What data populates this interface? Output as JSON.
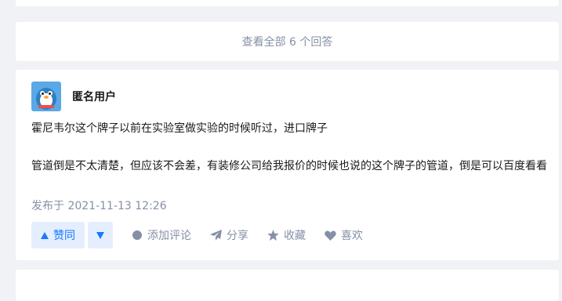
{
  "view_all": {
    "label": "查看全部 6 个回答"
  },
  "answer": {
    "author": "匿名用户",
    "paragraphs": [
      "霍尼韦尔这个牌子以前在实验室做实验的时候听过，进口牌子",
      "管道倒是不太清楚，但应该不会差，有装修公司给我报价的时候也说的这个牌子的管道，倒是可以百度看看"
    ],
    "published": "发布于 2021-11-13 12:26",
    "actions": {
      "upvote": "赞同",
      "comment": "添加评论",
      "share": "分享",
      "favorite": "收藏",
      "like": "喜欢"
    }
  },
  "colors": {
    "accent": "#1677ff",
    "muted": "#8590a6",
    "vote_bg": "#e5eefe"
  },
  "icons": [
    "upvote-icon",
    "downvote-icon",
    "comment-icon",
    "share-icon",
    "star-icon",
    "heart-icon"
  ]
}
